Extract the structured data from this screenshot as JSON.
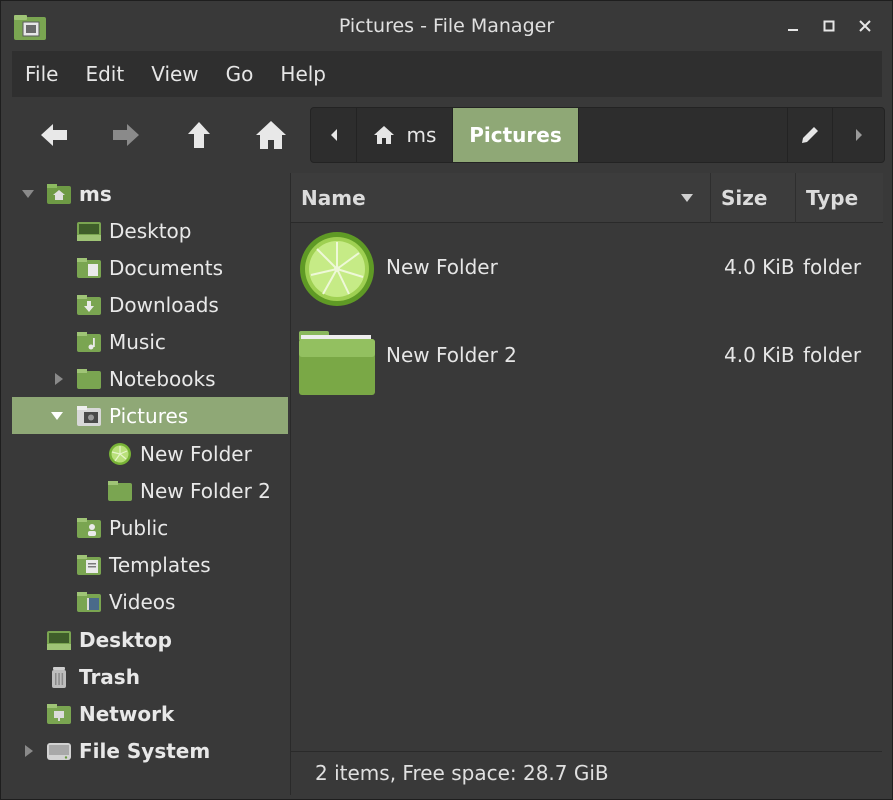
{
  "window": {
    "title": "Pictures - File Manager",
    "controls": [
      "minimize",
      "maximize",
      "close"
    ]
  },
  "menubar": {
    "items": [
      "File",
      "Edit",
      "View",
      "Go",
      "Help"
    ]
  },
  "toolbar": {
    "buttons": [
      "back-arrow-icon",
      "forward-arrow-icon",
      "up-arrow-icon",
      "home-icon"
    ]
  },
  "pathbar": {
    "segments": [
      {
        "label": "ms",
        "icon": "home-icon",
        "active": false
      },
      {
        "label": "Pictures",
        "active": true
      }
    ]
  },
  "sidebar": {
    "items": [
      {
        "label": "ms",
        "level": 0,
        "bold": true,
        "expanded": true,
        "icon": "home-folder-icon"
      },
      {
        "label": "Desktop",
        "level": 1,
        "icon": "desktop-folder-icon"
      },
      {
        "label": "Documents",
        "level": 1,
        "icon": "documents-folder-icon"
      },
      {
        "label": "Downloads",
        "level": 1,
        "icon": "downloads-folder-icon"
      },
      {
        "label": "Music",
        "level": 1,
        "icon": "music-folder-icon"
      },
      {
        "label": "Notebooks",
        "level": 1,
        "expandable": true,
        "icon": "folder-icon"
      },
      {
        "label": "Pictures",
        "level": 1,
        "selected": true,
        "expanded": true,
        "icon": "pictures-folder-icon"
      },
      {
        "label": "New Folder",
        "level": 2,
        "icon": "lime-folder-icon"
      },
      {
        "label": "New Folder 2",
        "level": 2,
        "icon": "folder-icon"
      },
      {
        "label": "Public",
        "level": 1,
        "icon": "public-folder-icon"
      },
      {
        "label": "Templates",
        "level": 1,
        "icon": "templates-folder-icon"
      },
      {
        "label": "Videos",
        "level": 1,
        "icon": "videos-folder-icon"
      },
      {
        "label": "Desktop",
        "level": 0,
        "bold": true,
        "icon": "desktop-icon"
      },
      {
        "label": "Trash",
        "level": 0,
        "bold": true,
        "icon": "trash-icon"
      },
      {
        "label": "Network",
        "level": 0,
        "bold": true,
        "icon": "network-icon"
      },
      {
        "label": "File System",
        "level": 0,
        "bold": true,
        "expandable": true,
        "icon": "drive-icon"
      }
    ]
  },
  "filelist": {
    "columns": {
      "name": "Name",
      "size": "Size",
      "type": "Type"
    },
    "rows": [
      {
        "name": "New Folder",
        "size": "4.0 KiB",
        "type": "folder",
        "icon": "lime-folder-icon"
      },
      {
        "name": "New Folder 2",
        "size": "4.0 KiB",
        "type": "folder",
        "icon": "folder-icon"
      }
    ]
  },
  "statusbar": {
    "text": "2 items, Free space: 28.7 GiB"
  },
  "colors": {
    "accent": "#8fa876",
    "background": "#393939",
    "menubar": "#2f2f2f",
    "text": "#e8e8e8"
  }
}
